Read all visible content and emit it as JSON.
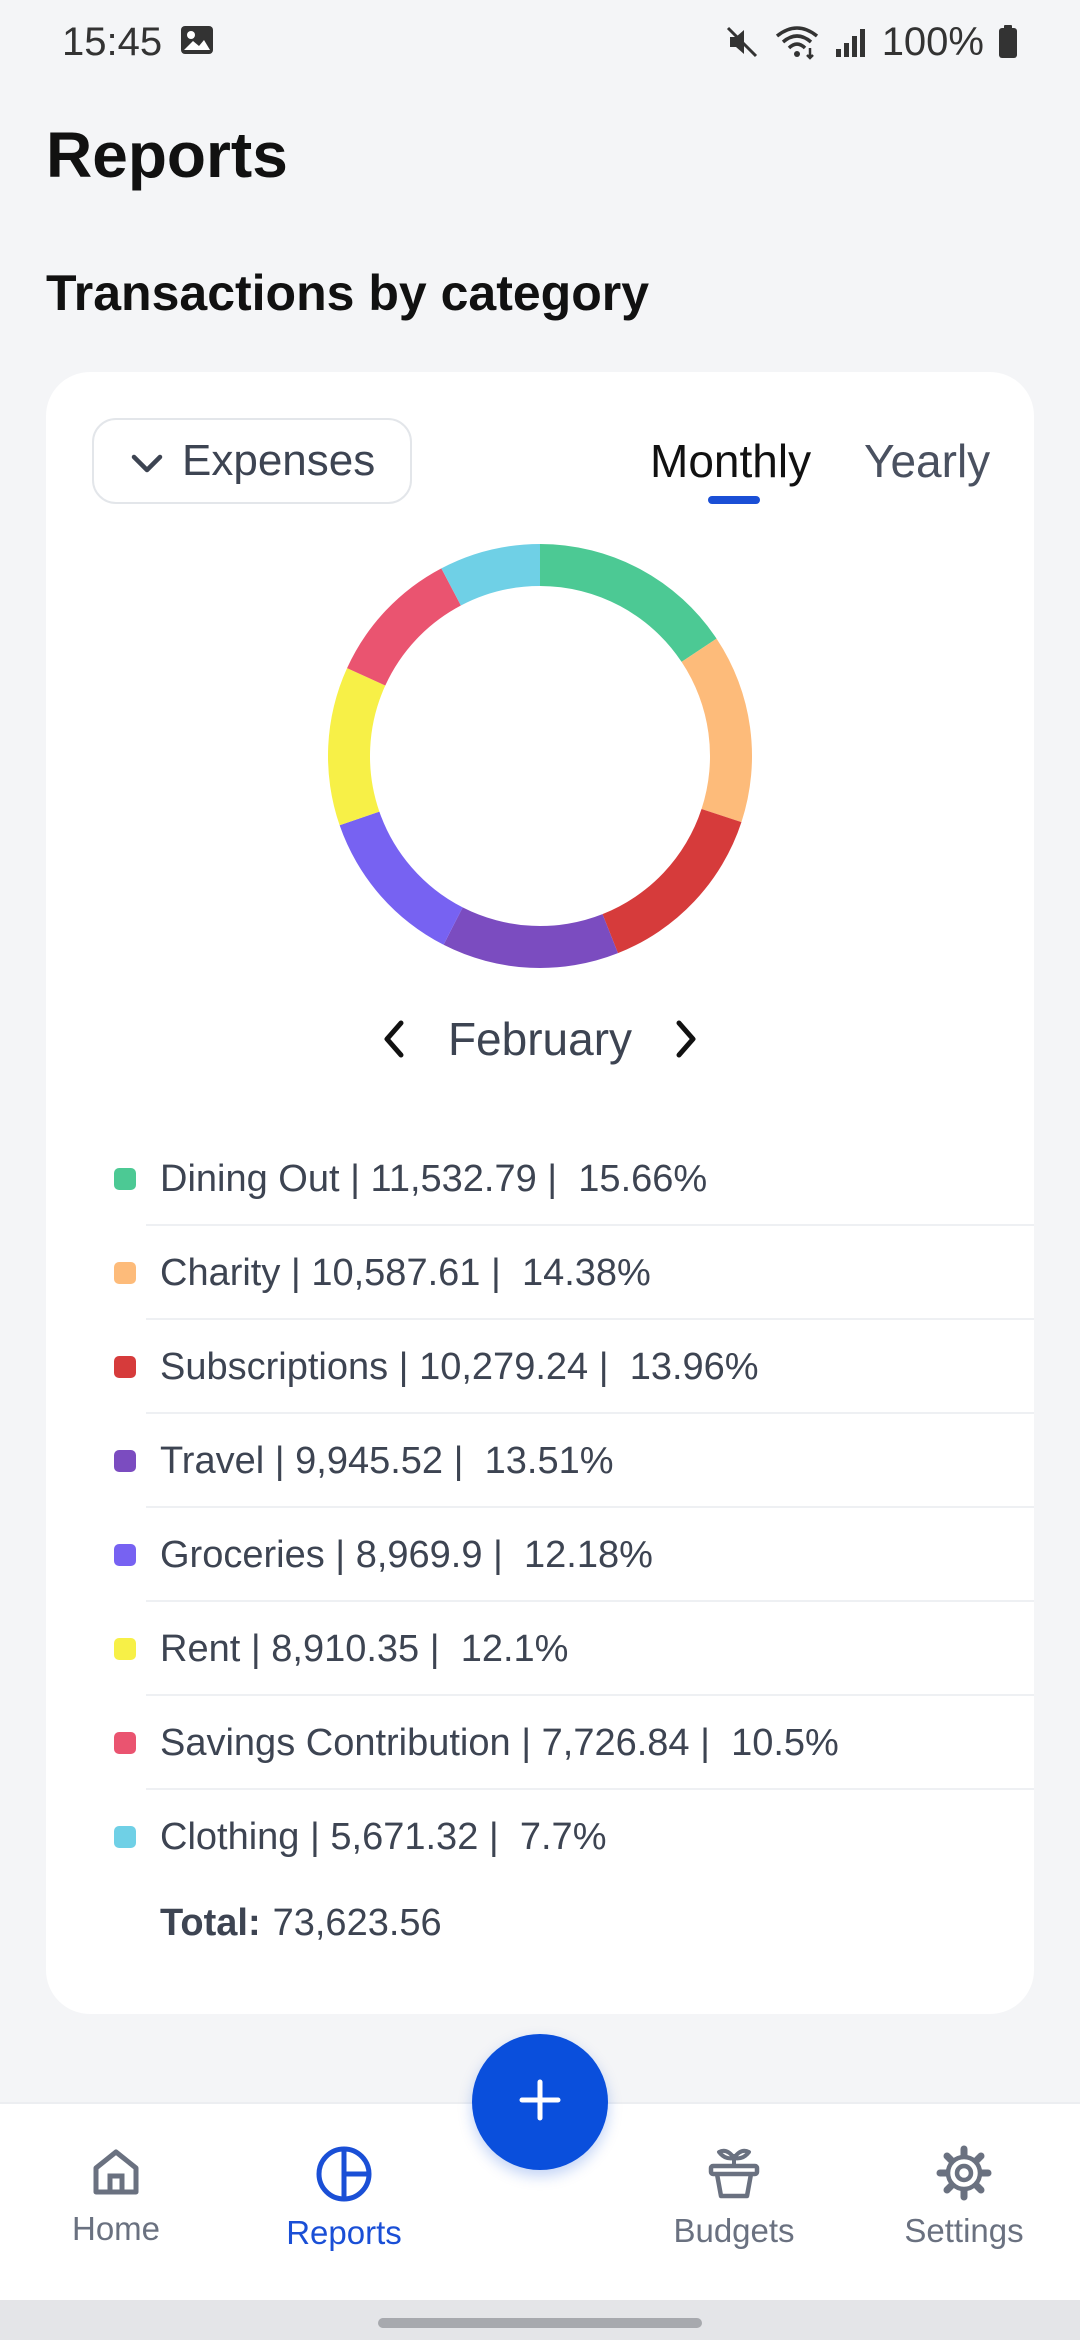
{
  "status": {
    "time": "15:45",
    "battery": "100%"
  },
  "page_title": "Reports",
  "section_title": "Transactions by category",
  "filter": {
    "type_selected": "Expenses"
  },
  "tabs": [
    {
      "label": "Monthly",
      "active": true
    },
    {
      "label": "Yearly",
      "active": false
    }
  ],
  "period": {
    "month": "February"
  },
  "chart_data": {
    "type": "pie",
    "donut": true,
    "categories": [
      "Dining Out",
      "Charity",
      "Subscriptions",
      "Travel",
      "Groceries",
      "Rent",
      "Savings Contribution",
      "Clothing"
    ],
    "values": [
      11532.79,
      10587.61,
      10279.24,
      9945.52,
      8969.9,
      8910.35,
      7726.84,
      5671.32
    ],
    "percents": [
      15.66,
      14.38,
      13.96,
      13.51,
      12.18,
      12.1,
      10.5,
      7.7
    ],
    "colors": [
      "#4cc994",
      "#fdbb7a",
      "#d63b3b",
      "#7b4cc0",
      "#7762f2",
      "#f7f047",
      "#ea5470",
      "#6fd0e6"
    ]
  },
  "legend": [
    {
      "text": "Dining Out | 11,532.79 |  15.66%",
      "color": "#4cc994"
    },
    {
      "text": "Charity | 10,587.61 |  14.38%",
      "color": "#fdbb7a"
    },
    {
      "text": "Subscriptions | 10,279.24 |  13.96%",
      "color": "#d63b3b"
    },
    {
      "text": "Travel | 9,945.52 |  13.51%",
      "color": "#7b4cc0"
    },
    {
      "text": "Groceries | 8,969.9 |  12.18%",
      "color": "#7762f2"
    },
    {
      "text": "Rent | 8,910.35 |  12.1%",
      "color": "#f7f047"
    },
    {
      "text": "Savings Contribution | 7,726.84 |  10.5%",
      "color": "#ea5470"
    },
    {
      "text": "Clothing | 5,671.32 |  7.7%",
      "color": "#6fd0e6"
    }
  ],
  "total": {
    "label": "Total:",
    "value": "73,623.56"
  },
  "nav": {
    "home": "Home",
    "reports": "Reports",
    "budgets": "Budgets",
    "settings": "Settings"
  },
  "colors": {
    "accent": "#0a4fdc",
    "active_nav": "#1a4fd6"
  },
  "icons": [
    "image-icon",
    "mute-icon",
    "wifi-icon",
    "signal-icon",
    "battery-icon",
    "chevron-down-icon",
    "chevron-left-icon",
    "chevron-right-icon",
    "plus-icon",
    "home-icon",
    "reports-icon",
    "budgets-icon",
    "settings-icon"
  ]
}
